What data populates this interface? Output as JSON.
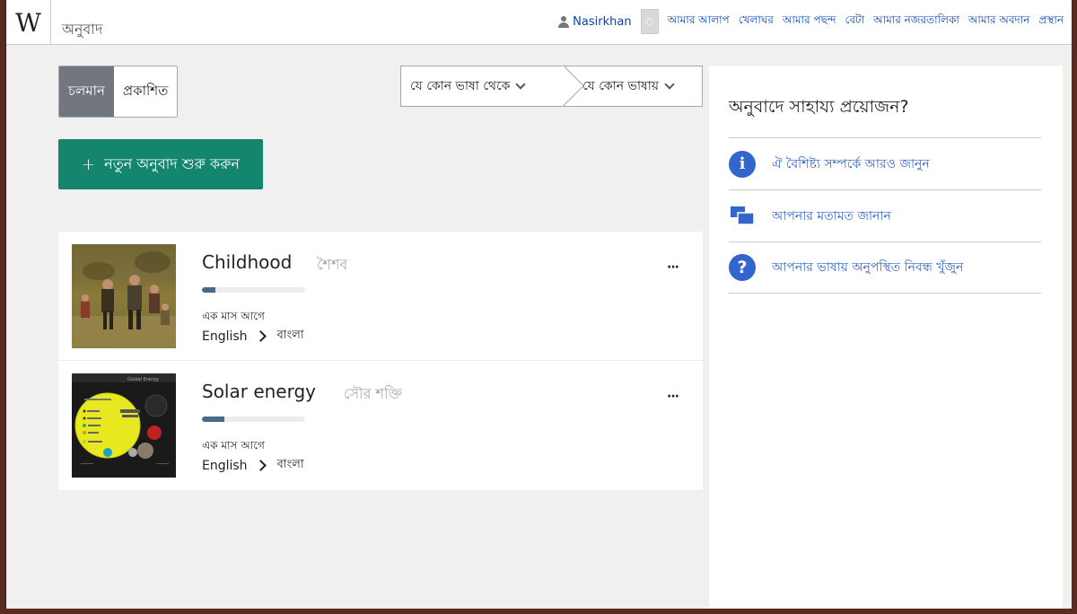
{
  "header": {
    "logo": "W",
    "title": "অনুবাদ",
    "user": "Nasirkhan",
    "notif_glyph": "○",
    "links": [
      "আমার আলাপ",
      "খেলাঘর",
      "আমার পছন্দ",
      "বেটা",
      "আমার নজরতালিকা",
      "আমার অবদান",
      "প্রস্থান"
    ]
  },
  "filters": {
    "active": "চলমান",
    "published": "প্রকাশিত",
    "source_lang": "যে কোন ভাষা থেকে",
    "target_lang": "যে কোন ভাষায়"
  },
  "new_translation": {
    "icon": "+",
    "label": "নতুন অনুবাদ শুরু করুন"
  },
  "translations": [
    {
      "title": "Childhood",
      "target_title": "শৈশব",
      "progress": 0.13,
      "time": "এক মাস আগে",
      "source_lang": "English",
      "target_lang": "বাংলা",
      "menu": "···"
    },
    {
      "title": "Solar energy",
      "target_title": "সৌর শক্তি",
      "progress": 0.22,
      "time": "এক মাস আগে",
      "source_lang": "English",
      "target_lang": "বাংলা",
      "menu": "···"
    }
  ],
  "help": {
    "title": "অনুবাদে সাহায্য প্রয়োজন?",
    "items": [
      {
        "icon": "info-icon",
        "glyph": "i",
        "label": "ঐ বৈশিষ্ট্য সম্পর্কে আরও জানুন"
      },
      {
        "icon": "feedback-icon",
        "label": "আপনার মতামত জানান"
      },
      {
        "icon": "help-question-icon",
        "glyph": "?",
        "label": "আপনার ভাষায় অনুপস্থিত নিবন্ধ খুঁজুন"
      }
    ]
  },
  "colors": {
    "primary_button": "#14866d",
    "link": "#0645ad",
    "help_icon": "#3366cc",
    "active_tab": "#72777d",
    "progress": "#4a6a8c"
  }
}
